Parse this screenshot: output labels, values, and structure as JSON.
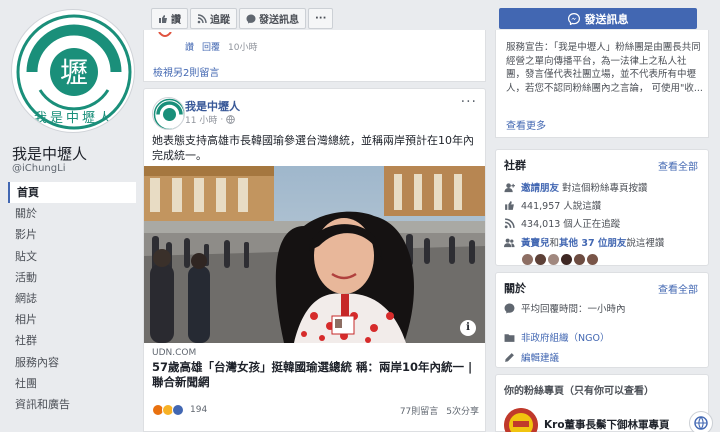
{
  "page": {
    "name": "我是中壢人",
    "handle": "@iChungLi",
    "logo_text": "我是中壢人",
    "logo_char": "壢"
  },
  "nav": [
    {
      "label": "首頁",
      "active": true
    },
    {
      "label": "關於",
      "active": false
    },
    {
      "label": "影片",
      "active": false
    },
    {
      "label": "貼文",
      "active": false
    },
    {
      "label": "活動",
      "active": false
    },
    {
      "label": "網誌",
      "active": false
    },
    {
      "label": "相片",
      "active": false
    },
    {
      "label": "社群",
      "active": false
    },
    {
      "label": "服務內容",
      "active": false
    },
    {
      "label": "社團",
      "active": false
    },
    {
      "label": "資訊和廣告",
      "active": false
    }
  ],
  "actionbar": {
    "like": "讚",
    "follow": "追蹤",
    "send": "發送訊息",
    "more": "···"
  },
  "send_message_button": "發送訊息",
  "prev_post": {
    "like": "讚",
    "reply": "回覆",
    "time": "10小時",
    "view_more": "檢視另2則留言"
  },
  "post": {
    "author": "我是中壢人",
    "time": "11 小時",
    "text": "她表態支持高雄市長韓國瑜參選台灣總統，並稱兩岸預計在10年內完成統一。",
    "link_domain": "UDN.COM",
    "link_title": "57歲高雄「台灣女孩」挺韓國瑜選總統 稱：兩岸10年內統一 | 聯合新聞網",
    "reaction_count": "194",
    "comments": "77則留言",
    "shares": "5次分享",
    "info": "i",
    "menu": "···"
  },
  "about": {
    "text": "服務宣告：「我是中壢人」粉絲團是由團長共同經營之單向傳播平台，為一法律上之私人社團，發言僅代表社團立場，並不代表所有中壢人，若您不認同粉絲團內之言論， 可使用\"收...",
    "more": "查看更多"
  },
  "community": {
    "title": "社群",
    "see_all": "查看全部",
    "invite_link": "邀請朋友",
    "invite_rest": "對這個粉絲專頁按讚",
    "likes": "441,957 人說這讚",
    "follows": "434,013 個人正在追蹤",
    "friends_link": "黃寶兒",
    "friends_mid": "和",
    "friends_others": "其他 37 位朋友",
    "friends_rest": "說這裡讚"
  },
  "about_box": {
    "title": "關於",
    "see_all": "查看全部",
    "response": "平均回覆時間：一小時內",
    "category": "非政府組織（NGO）",
    "edit": "編輯建議"
  },
  "liked_pages": {
    "title": "你的粉絲專頁（只有你可以查看）",
    "page_name": "Kro董事長鬃下御林軍專頁"
  },
  "colors": {
    "brand_blue": "#4267b2",
    "link_blue": "#385898",
    "logo_green": "#1a8f7a",
    "background": "#e9ebee"
  }
}
